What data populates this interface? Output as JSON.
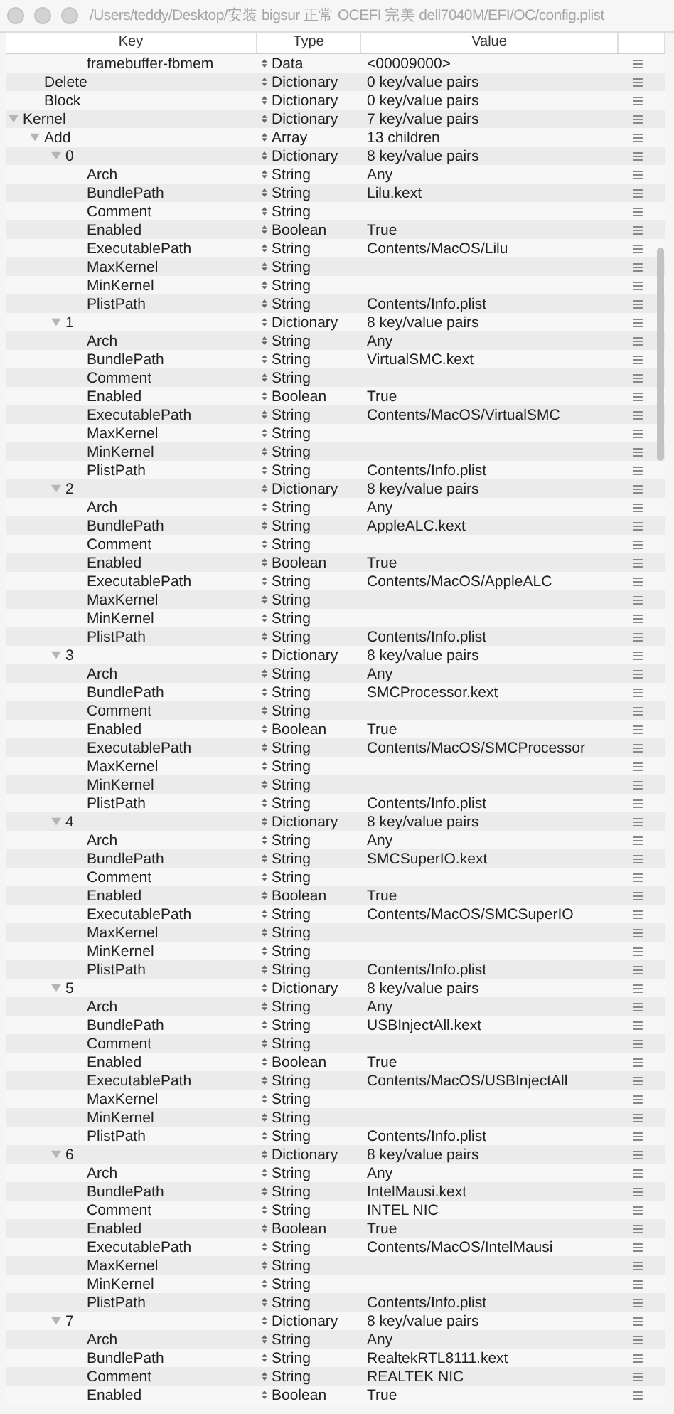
{
  "window": {
    "title": "/Users/teddy/Desktop/安装 bigsur 正常 OCEFI 完美 dell7040M/EFI/OC/config.plist"
  },
  "table": {
    "columns": [
      "Key",
      "Type",
      "Value"
    ],
    "rows": [
      {
        "children": [
          {
            "children": [
              {
                "children": [
                  {
                    "key": "framebuffer-fbmem",
                    "type": "Data",
                    "value": "<00009000>"
                  }
                ]
              }
            ]
          },
          {
            "key": "Delete",
            "type": "Dictionary",
            "value": "0 key/value pairs"
          },
          {
            "key": "Block",
            "type": "Dictionary",
            "value": "0 key/value pairs"
          }
        ]
      },
      {
        "key": "Kernel",
        "type": "Dictionary",
        "value": "7 key/value pairs",
        "expanded": true,
        "children": [
          {
            "key": "Add",
            "type": "Array",
            "value": "13 children",
            "expanded": true,
            "children": [
              {
                "key": "0",
                "type": "Dictionary",
                "value": "8 key/value pairs",
                "expanded": true,
                "children": [
                  {
                    "key": "Arch",
                    "type": "String",
                    "value": "Any"
                  },
                  {
                    "key": "BundlePath",
                    "type": "String",
                    "value": "Lilu.kext"
                  },
                  {
                    "key": "Comment",
                    "type": "String"
                  },
                  {
                    "key": "Enabled",
                    "type": "Boolean",
                    "value": "True"
                  },
                  {
                    "key": "ExecutablePath",
                    "type": "String",
                    "value": "Contents/MacOS/Lilu"
                  },
                  {
                    "key": "MaxKernel",
                    "type": "String"
                  },
                  {
                    "key": "MinKernel",
                    "type": "String"
                  },
                  {
                    "key": "PlistPath",
                    "type": "String",
                    "value": "Contents/Info.plist"
                  }
                ]
              },
              {
                "key": "1",
                "type": "Dictionary",
                "value": "8 key/value pairs",
                "expanded": true,
                "children": [
                  {
                    "key": "Arch",
                    "type": "String",
                    "value": "Any"
                  },
                  {
                    "key": "BundlePath",
                    "type": "String",
                    "value": "VirtualSMC.kext"
                  },
                  {
                    "key": "Comment",
                    "type": "String"
                  },
                  {
                    "key": "Enabled",
                    "type": "Boolean",
                    "value": "True"
                  },
                  {
                    "key": "ExecutablePath",
                    "type": "String",
                    "value": "Contents/MacOS/VirtualSMC"
                  },
                  {
                    "key": "MaxKernel",
                    "type": "String"
                  },
                  {
                    "key": "MinKernel",
                    "type": "String"
                  },
                  {
                    "key": "PlistPath",
                    "type": "String",
                    "value": "Contents/Info.plist"
                  }
                ]
              },
              {
                "key": "2",
                "type": "Dictionary",
                "value": "8 key/value pairs",
                "expanded": true,
                "children": [
                  {
                    "key": "Arch",
                    "type": "String",
                    "value": "Any"
                  },
                  {
                    "key": "BundlePath",
                    "type": "String",
                    "value": "AppleALC.kext"
                  },
                  {
                    "key": "Comment",
                    "type": "String"
                  },
                  {
                    "key": "Enabled",
                    "type": "Boolean",
                    "value": "True"
                  },
                  {
                    "key": "ExecutablePath",
                    "type": "String",
                    "value": "Contents/MacOS/AppleALC"
                  },
                  {
                    "key": "MaxKernel",
                    "type": "String"
                  },
                  {
                    "key": "MinKernel",
                    "type": "String"
                  },
                  {
                    "key": "PlistPath",
                    "type": "String",
                    "value": "Contents/Info.plist"
                  }
                ]
              },
              {
                "key": "3",
                "type": "Dictionary",
                "value": "8 key/value pairs",
                "expanded": true,
                "children": [
                  {
                    "key": "Arch",
                    "type": "String",
                    "value": "Any"
                  },
                  {
                    "key": "BundlePath",
                    "type": "String",
                    "value": "SMCProcessor.kext"
                  },
                  {
                    "key": "Comment",
                    "type": "String"
                  },
                  {
                    "key": "Enabled",
                    "type": "Boolean",
                    "value": "True"
                  },
                  {
                    "key": "ExecutablePath",
                    "type": "String",
                    "value": "Contents/MacOS/SMCProcessor"
                  },
                  {
                    "key": "MaxKernel",
                    "type": "String"
                  },
                  {
                    "key": "MinKernel",
                    "type": "String"
                  },
                  {
                    "key": "PlistPath",
                    "type": "String",
                    "value": "Contents/Info.plist"
                  }
                ]
              },
              {
                "key": "4",
                "type": "Dictionary",
                "value": "8 key/value pairs",
                "expanded": true,
                "children": [
                  {
                    "key": "Arch",
                    "type": "String",
                    "value": "Any"
                  },
                  {
                    "key": "BundlePath",
                    "type": "String",
                    "value": "SMCSuperIO.kext"
                  },
                  {
                    "key": "Comment",
                    "type": "String"
                  },
                  {
                    "key": "Enabled",
                    "type": "Boolean",
                    "value": "True"
                  },
                  {
                    "key": "ExecutablePath",
                    "type": "String",
                    "value": "Contents/MacOS/SMCSuperIO"
                  },
                  {
                    "key": "MaxKernel",
                    "type": "String"
                  },
                  {
                    "key": "MinKernel",
                    "type": "String"
                  },
                  {
                    "key": "PlistPath",
                    "type": "String",
                    "value": "Contents/Info.plist"
                  }
                ]
              },
              {
                "key": "5",
                "type": "Dictionary",
                "value": "8 key/value pairs",
                "expanded": true,
                "children": [
                  {
                    "key": "Arch",
                    "type": "String",
                    "value": "Any"
                  },
                  {
                    "key": "BundlePath",
                    "type": "String",
                    "value": "USBInjectAll.kext"
                  },
                  {
                    "key": "Comment",
                    "type": "String"
                  },
                  {
                    "key": "Enabled",
                    "type": "Boolean",
                    "value": "True"
                  },
                  {
                    "key": "ExecutablePath",
                    "type": "String",
                    "value": "Contents/MacOS/USBInjectAll"
                  },
                  {
                    "key": "MaxKernel",
                    "type": "String"
                  },
                  {
                    "key": "MinKernel",
                    "type": "String"
                  },
                  {
                    "key": "PlistPath",
                    "type": "String",
                    "value": "Contents/Info.plist"
                  }
                ]
              },
              {
                "key": "6",
                "type": "Dictionary",
                "value": "8 key/value pairs",
                "expanded": true,
                "children": [
                  {
                    "key": "Arch",
                    "type": "String",
                    "value": "Any"
                  },
                  {
                    "key": "BundlePath",
                    "type": "String",
                    "value": "IntelMausi.kext"
                  },
                  {
                    "key": "Comment",
                    "type": "String",
                    "value": "INTEL NIC"
                  },
                  {
                    "key": "Enabled",
                    "type": "Boolean",
                    "value": "True"
                  },
                  {
                    "key": "ExecutablePath",
                    "type": "String",
                    "value": "Contents/MacOS/IntelMausi"
                  },
                  {
                    "key": "MaxKernel",
                    "type": "String"
                  },
                  {
                    "key": "MinKernel",
                    "type": "String"
                  },
                  {
                    "key": "PlistPath",
                    "type": "String",
                    "value": "Contents/Info.plist"
                  }
                ]
              },
              {
                "key": "7",
                "type": "Dictionary",
                "value": "8 key/value pairs",
                "expanded": true,
                "children": [
                  {
                    "key": "Arch",
                    "type": "String",
                    "value": "Any"
                  },
                  {
                    "key": "BundlePath",
                    "type": "String",
                    "value": "RealtekRTL8111.kext"
                  },
                  {
                    "key": "Comment",
                    "type": "String",
                    "value": "REALTEK NIC"
                  },
                  {
                    "key": "Enabled",
                    "type": "Boolean",
                    "value": "True"
                  }
                ]
              }
            ]
          }
        ]
      }
    ]
  }
}
